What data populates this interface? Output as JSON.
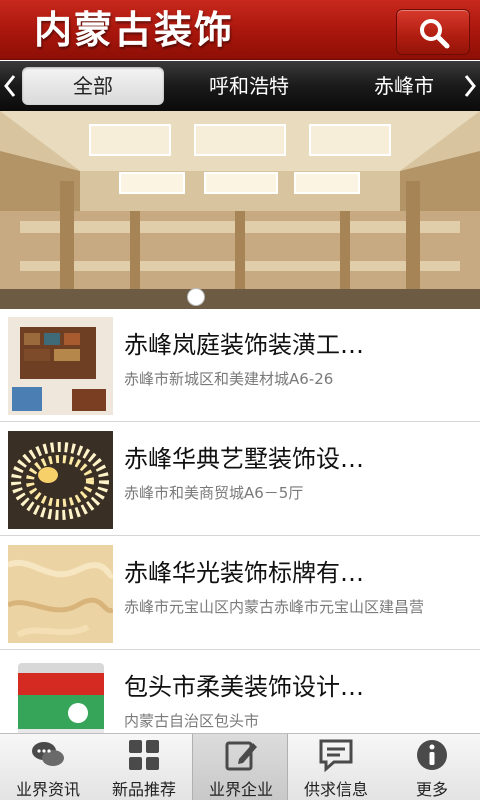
{
  "header": {
    "title": "内蒙古装饰",
    "search_icon": "search-icon"
  },
  "tabs": [
    {
      "label": "全部",
      "active": true
    },
    {
      "label": "呼和浩特",
      "active": false
    },
    {
      "label": "赤峰市",
      "active": false
    }
  ],
  "banner": {
    "image": "mall-interior-photo",
    "slides_total": 1,
    "active_slide": 1
  },
  "companies": [
    {
      "title": "赤峰岚庭装饰装潢工…",
      "address": "赤峰市新城区和美建材城A6-26",
      "thumb": "furniture-photo"
    },
    {
      "title": "赤峰华典艺墅装饰设…",
      "address": "赤峰市和美商贸城A6－5厅",
      "thumb": "led-strip-photo"
    },
    {
      "title": "赤峰华光装饰标牌有…",
      "address": "赤峰市元宝山区内蒙古赤峰市元宝山区建昌营",
      "thumb": "marble-texture-photo"
    },
    {
      "title": "包头市柔美装饰设计…",
      "address": "内蒙古自治区包头市",
      "thumb": "paint-bucket-photo"
    }
  ],
  "bottom_nav": [
    {
      "label": "业界资讯",
      "icon": "chat-bubbles-icon",
      "active": false
    },
    {
      "label": "新品推荐",
      "icon": "grid-icon",
      "active": false
    },
    {
      "label": "业界企业",
      "icon": "edit-icon",
      "active": true
    },
    {
      "label": "供求信息",
      "icon": "message-icon",
      "active": false
    },
    {
      "label": "更多",
      "icon": "info-icon",
      "active": false
    }
  ],
  "colors": {
    "header_red": "#b01d10",
    "tab_bar": "#1a1a1a",
    "address_gray": "#7a7a7a"
  }
}
